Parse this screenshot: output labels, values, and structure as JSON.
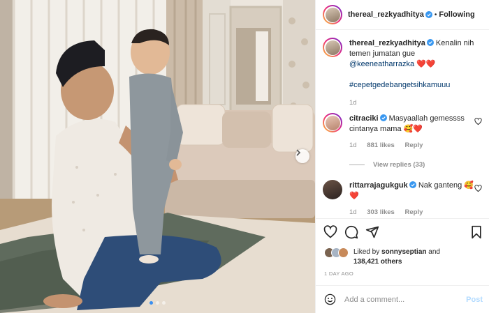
{
  "header": {
    "username": "thereal_rezkyadhitya",
    "separator": "•",
    "follow_status": "Following"
  },
  "caption": {
    "username": "thereal_rezkyadhitya",
    "text": "Kenalin nih temen jumatan gue",
    "mention": "@keeneatharrazka",
    "emoji": "❤️❤️",
    "hashtag": "#cepetgedebangetsihkamuuu",
    "time": "1d"
  },
  "comments": [
    {
      "username": "citraciki",
      "text": "Masyaallah gemessss cintanya mama",
      "emoji": "🥰❤️",
      "time": "1d",
      "likes": "881 likes",
      "reply_label": "Reply"
    },
    {
      "username": "rittarrajagukguk",
      "text": "Nak ganteng",
      "emoji": "🥰❤️",
      "time": "1d",
      "likes": "303 likes",
      "reply_label": "Reply"
    }
  ],
  "view_replies": "View replies (33)",
  "likes": {
    "prefix": "Liked by",
    "liker": "sonnyseptian",
    "joiner": "and",
    "others": "138,421 others"
  },
  "post_date": "1 DAY AGO",
  "add_comment": {
    "placeholder": "Add a comment...",
    "post_label": "Post"
  },
  "carousel": {
    "slides": 3,
    "active": 1
  },
  "colors": {
    "link": "#00376b",
    "verified": "#3897f0",
    "heart": "#ed4956",
    "muted": "#8e8e8e"
  }
}
